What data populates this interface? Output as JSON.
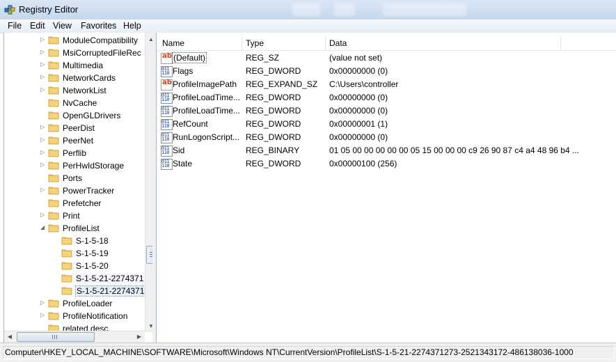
{
  "window": {
    "title": "Registry Editor"
  },
  "menu": [
    "File",
    "Edit",
    "View",
    "Favorites",
    "Help"
  ],
  "tree": [
    {
      "label": "ModuleCompatibility",
      "expandable": true,
      "indent": 1
    },
    {
      "label": "MsiCorruptedFileRec",
      "expandable": true,
      "indent": 1
    },
    {
      "label": "Multimedia",
      "expandable": true,
      "indent": 1
    },
    {
      "label": "NetworkCards",
      "expandable": true,
      "indent": 1
    },
    {
      "label": "NetworkList",
      "expandable": true,
      "indent": 1
    },
    {
      "label": "NvCache",
      "expandable": false,
      "indent": 1
    },
    {
      "label": "OpenGLDrivers",
      "expandable": false,
      "indent": 1
    },
    {
      "label": "PeerDist",
      "expandable": true,
      "indent": 1
    },
    {
      "label": "PeerNet",
      "expandable": true,
      "indent": 1
    },
    {
      "label": "Perflib",
      "expandable": true,
      "indent": 1
    },
    {
      "label": "PerHwIdStorage",
      "expandable": true,
      "indent": 1
    },
    {
      "label": "Ports",
      "expandable": false,
      "indent": 1
    },
    {
      "label": "PowerTracker",
      "expandable": true,
      "indent": 1
    },
    {
      "label": "Prefetcher",
      "expandable": false,
      "indent": 1
    },
    {
      "label": "Print",
      "expandable": true,
      "indent": 1
    },
    {
      "label": "ProfileList",
      "expandable": true,
      "expanded": true,
      "indent": 1
    },
    {
      "label": "S-1-5-18",
      "expandable": false,
      "indent": 2
    },
    {
      "label": "S-1-5-19",
      "expandable": false,
      "indent": 2
    },
    {
      "label": "S-1-5-20",
      "expandable": false,
      "indent": 2
    },
    {
      "label": "S-1-5-21-2274371",
      "expandable": false,
      "indent": 2,
      "hot": true
    },
    {
      "label": "S-1-5-21-2274371",
      "expandable": false,
      "indent": 2,
      "selected": true
    },
    {
      "label": "ProfileLoader",
      "expandable": true,
      "indent": 1
    },
    {
      "label": "ProfileNotification",
      "expandable": true,
      "indent": 1
    },
    {
      "label": "related.desc",
      "expandable": false,
      "indent": 1
    }
  ],
  "list": {
    "columns": [
      "Name",
      "Type",
      "Data"
    ],
    "rows": [
      {
        "icon": "string-value-icon",
        "name": "(Default)",
        "type": "REG_SZ",
        "data": "(value not set)",
        "focused": true
      },
      {
        "icon": "binary-value-icon",
        "name": "Flags",
        "type": "REG_DWORD",
        "data": "0x00000000 (0)"
      },
      {
        "icon": "string-value-icon",
        "name": "ProfileImagePath",
        "type": "REG_EXPAND_SZ",
        "data": "C:\\Users\\controller"
      },
      {
        "icon": "binary-value-icon",
        "name": "ProfileLoadTime...",
        "type": "REG_DWORD",
        "data": "0x00000000 (0)"
      },
      {
        "icon": "binary-value-icon",
        "name": "ProfileLoadTime...",
        "type": "REG_DWORD",
        "data": "0x00000000 (0)"
      },
      {
        "icon": "binary-value-icon",
        "name": "RefCount",
        "type": "REG_DWORD",
        "data": "0x00000001 (1)"
      },
      {
        "icon": "binary-value-icon",
        "name": "RunLogonScript...",
        "type": "REG_DWORD",
        "data": "0x00000000 (0)"
      },
      {
        "icon": "binary-value-icon",
        "name": "Sid",
        "type": "REG_BINARY",
        "data": "01 05 00 00 00 00 00 05 15 00 00 00 c9 26 90 87 c4 a4 48 96 b4 ..."
      },
      {
        "icon": "binary-value-icon",
        "name": "State",
        "type": "REG_DWORD",
        "data": "0x00000100 (256)"
      }
    ]
  },
  "status": {
    "path": "Computer\\HKEY_LOCAL_MACHINE\\SOFTWARE\\Microsoft\\Windows NT\\CurrentVersion\\ProfileList\\S-1-5-21-2274371273-2521343172-486138036-1000"
  },
  "colors": {
    "folder": "#e8c05a",
    "folder_dark": "#c89a2e",
    "selection": "#e7eef7",
    "titlebar": "#c5d7ec"
  }
}
